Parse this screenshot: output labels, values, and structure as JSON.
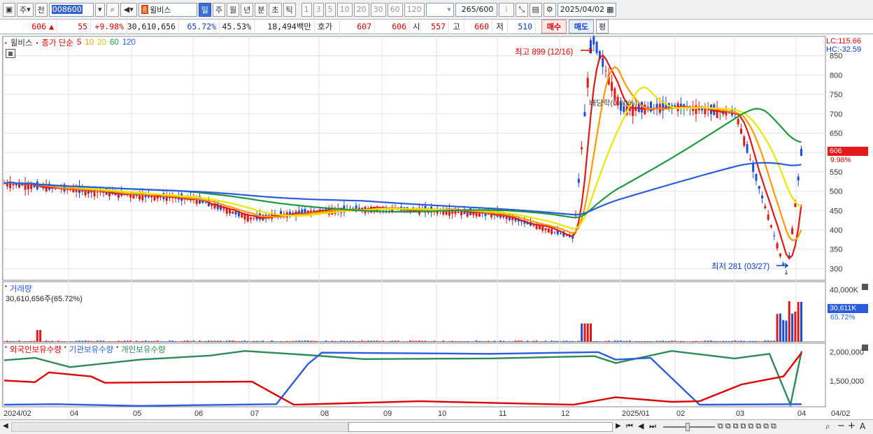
{
  "toolbar": {
    "market": "주",
    "prev_label": "전",
    "code": "008600",
    "stock_name": "윌비스",
    "period_tabs": [
      "일",
      "주",
      "월",
      "년",
      "분",
      "초",
      "틱"
    ],
    "active_period": "일",
    "minute_options": [
      "1",
      "3",
      "5",
      "10",
      "20",
      "30",
      "60",
      "120"
    ],
    "count": "265",
    "count_max": "/600",
    "date": "2025/04/02"
  },
  "info": {
    "price": "606",
    "change": "55",
    "change_pct": "+9.98%",
    "volume": "30,610,656",
    "vol_ratio": "65.72%",
    "rate2": "45.53%",
    "amount": "18,494백만",
    "hoga_label": "호가",
    "ask": "607",
    "bid": "606",
    "open_label": "시",
    "open": "557",
    "high_label": "고",
    "high": "660",
    "low_label": "저",
    "low": "510",
    "buy_btn": "매수",
    "sell_btn": "매도",
    "eval_btn": "평"
  },
  "price_panel": {
    "title": "윌비스",
    "ma_label": "종가 단순",
    "ma_periods": [
      "5",
      "10",
      "20",
      "60",
      "120"
    ],
    "ma_colors": [
      "#e01818",
      "#ff9900",
      "#e8e800",
      "#1c9a3c",
      "#2a5ce0"
    ],
    "lc": "LC:115.66",
    "hc": "HC:-32.59",
    "high_note": "최고 899 (12/16)",
    "low_note": "최저 281 (03/27)",
    "overlap_note": "배당락(0.00%)",
    "cur_price": "606",
    "cur_pct": "9.98%",
    "y_ticks": [
      "850",
      "800",
      "750",
      "700",
      "650",
      "600",
      "550",
      "500",
      "450",
      "400",
      "350",
      "300"
    ]
  },
  "volume_panel": {
    "title": "거래량",
    "value": "30,610,656주(65.72%)",
    "y_ticks": [
      "40,000K"
    ],
    "cur_value": "30,611K",
    "cur_pct": "65.72%"
  },
  "holding_panel": {
    "legend": [
      "외국인보유수량",
      "기관보유수량",
      "개인보유수량"
    ],
    "legend_colors": [
      "#d00",
      "#2a5ce0",
      "#2e8b57"
    ],
    "y_ticks": [
      "2,000,000",
      "1,500,000"
    ]
  },
  "x_axis": {
    "labels": [
      "2024/02",
      "04",
      "05",
      "06",
      "07",
      "08",
      "09",
      "10",
      "11",
      "12",
      "2025/01",
      "02",
      "03",
      "04"
    ],
    "end_date": "04/02"
  },
  "chart_data": [
    {
      "type": "line",
      "name_ko": "price",
      "description": "daily candles, approximate closing prices",
      "x": [
        "2024/02",
        "2024/04",
        "2024/05",
        "2024/06",
        "2024/07",
        "2024/08",
        "2024/09",
        "2024/10",
        "2024/11",
        "2024/12",
        "2024/12/16",
        "2025/01",
        "2025/02",
        "2025/03",
        "2025/03/27",
        "2025/04/02"
      ],
      "close": [
        520,
        505,
        490,
        480,
        430,
        450,
        455,
        450,
        440,
        380,
        899,
        710,
        720,
        700,
        281,
        606
      ],
      "ylim": [
        270,
        900
      ]
    },
    {
      "type": "bar",
      "name_ko": "거래량",
      "note": "volume spikes near 2024/02, 2024/12 and 2025/04",
      "x": [
        "2024/02",
        "2024/12",
        "2025/04"
      ],
      "values_k": [
        9000,
        14000,
        30611
      ]
    }
  ]
}
